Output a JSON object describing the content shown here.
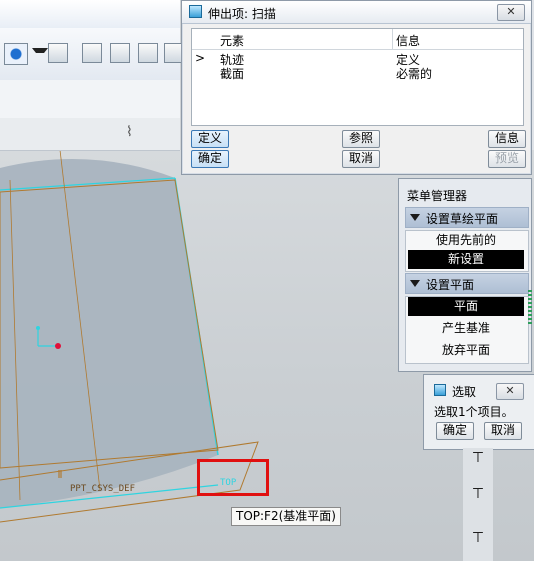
{
  "extrude_dialog": {
    "title": "伸出项: 扫描",
    "close_label": "✕",
    "columns": [
      "元素",
      "信息"
    ],
    "rows": [
      {
        "marker": ">",
        "element": "轨迹",
        "info": "定义"
      },
      {
        "marker": "",
        "element": "截面",
        "info": "必需的"
      }
    ],
    "buttons": {
      "define": "定义",
      "reference": "参照",
      "info": "信息",
      "ok": "确定",
      "cancel": "取消",
      "preview": "预览"
    }
  },
  "menu_manager": {
    "title": "菜单管理器",
    "sections": [
      {
        "header": "设置草绘平面",
        "items": [
          {
            "label": "使用先前的",
            "highlighted": false
          },
          {
            "label": "新设置",
            "highlighted": true
          }
        ]
      },
      {
        "header": "设置平面",
        "items": [
          {
            "label": "平面",
            "highlighted": true
          },
          {
            "label": "产生基准",
            "highlighted": false
          },
          {
            "label": "放弃平面",
            "highlighted": false
          }
        ]
      }
    ]
  },
  "select_dialog": {
    "title": "选取",
    "close_label": "✕",
    "prompt": "选取1个项目。",
    "ok": "确定",
    "cancel": "取消"
  },
  "viewport": {
    "csys_label": "PPT_CSYS_DEF",
    "plane_label": "TOP",
    "tooltip": "TOP:F2(基准平面)"
  },
  "colors": {
    "highlight_box": "#e01010",
    "selected_edge": "#2fd4e0",
    "datum_plane": "#b07a30",
    "menu_highlight": "#000000"
  }
}
